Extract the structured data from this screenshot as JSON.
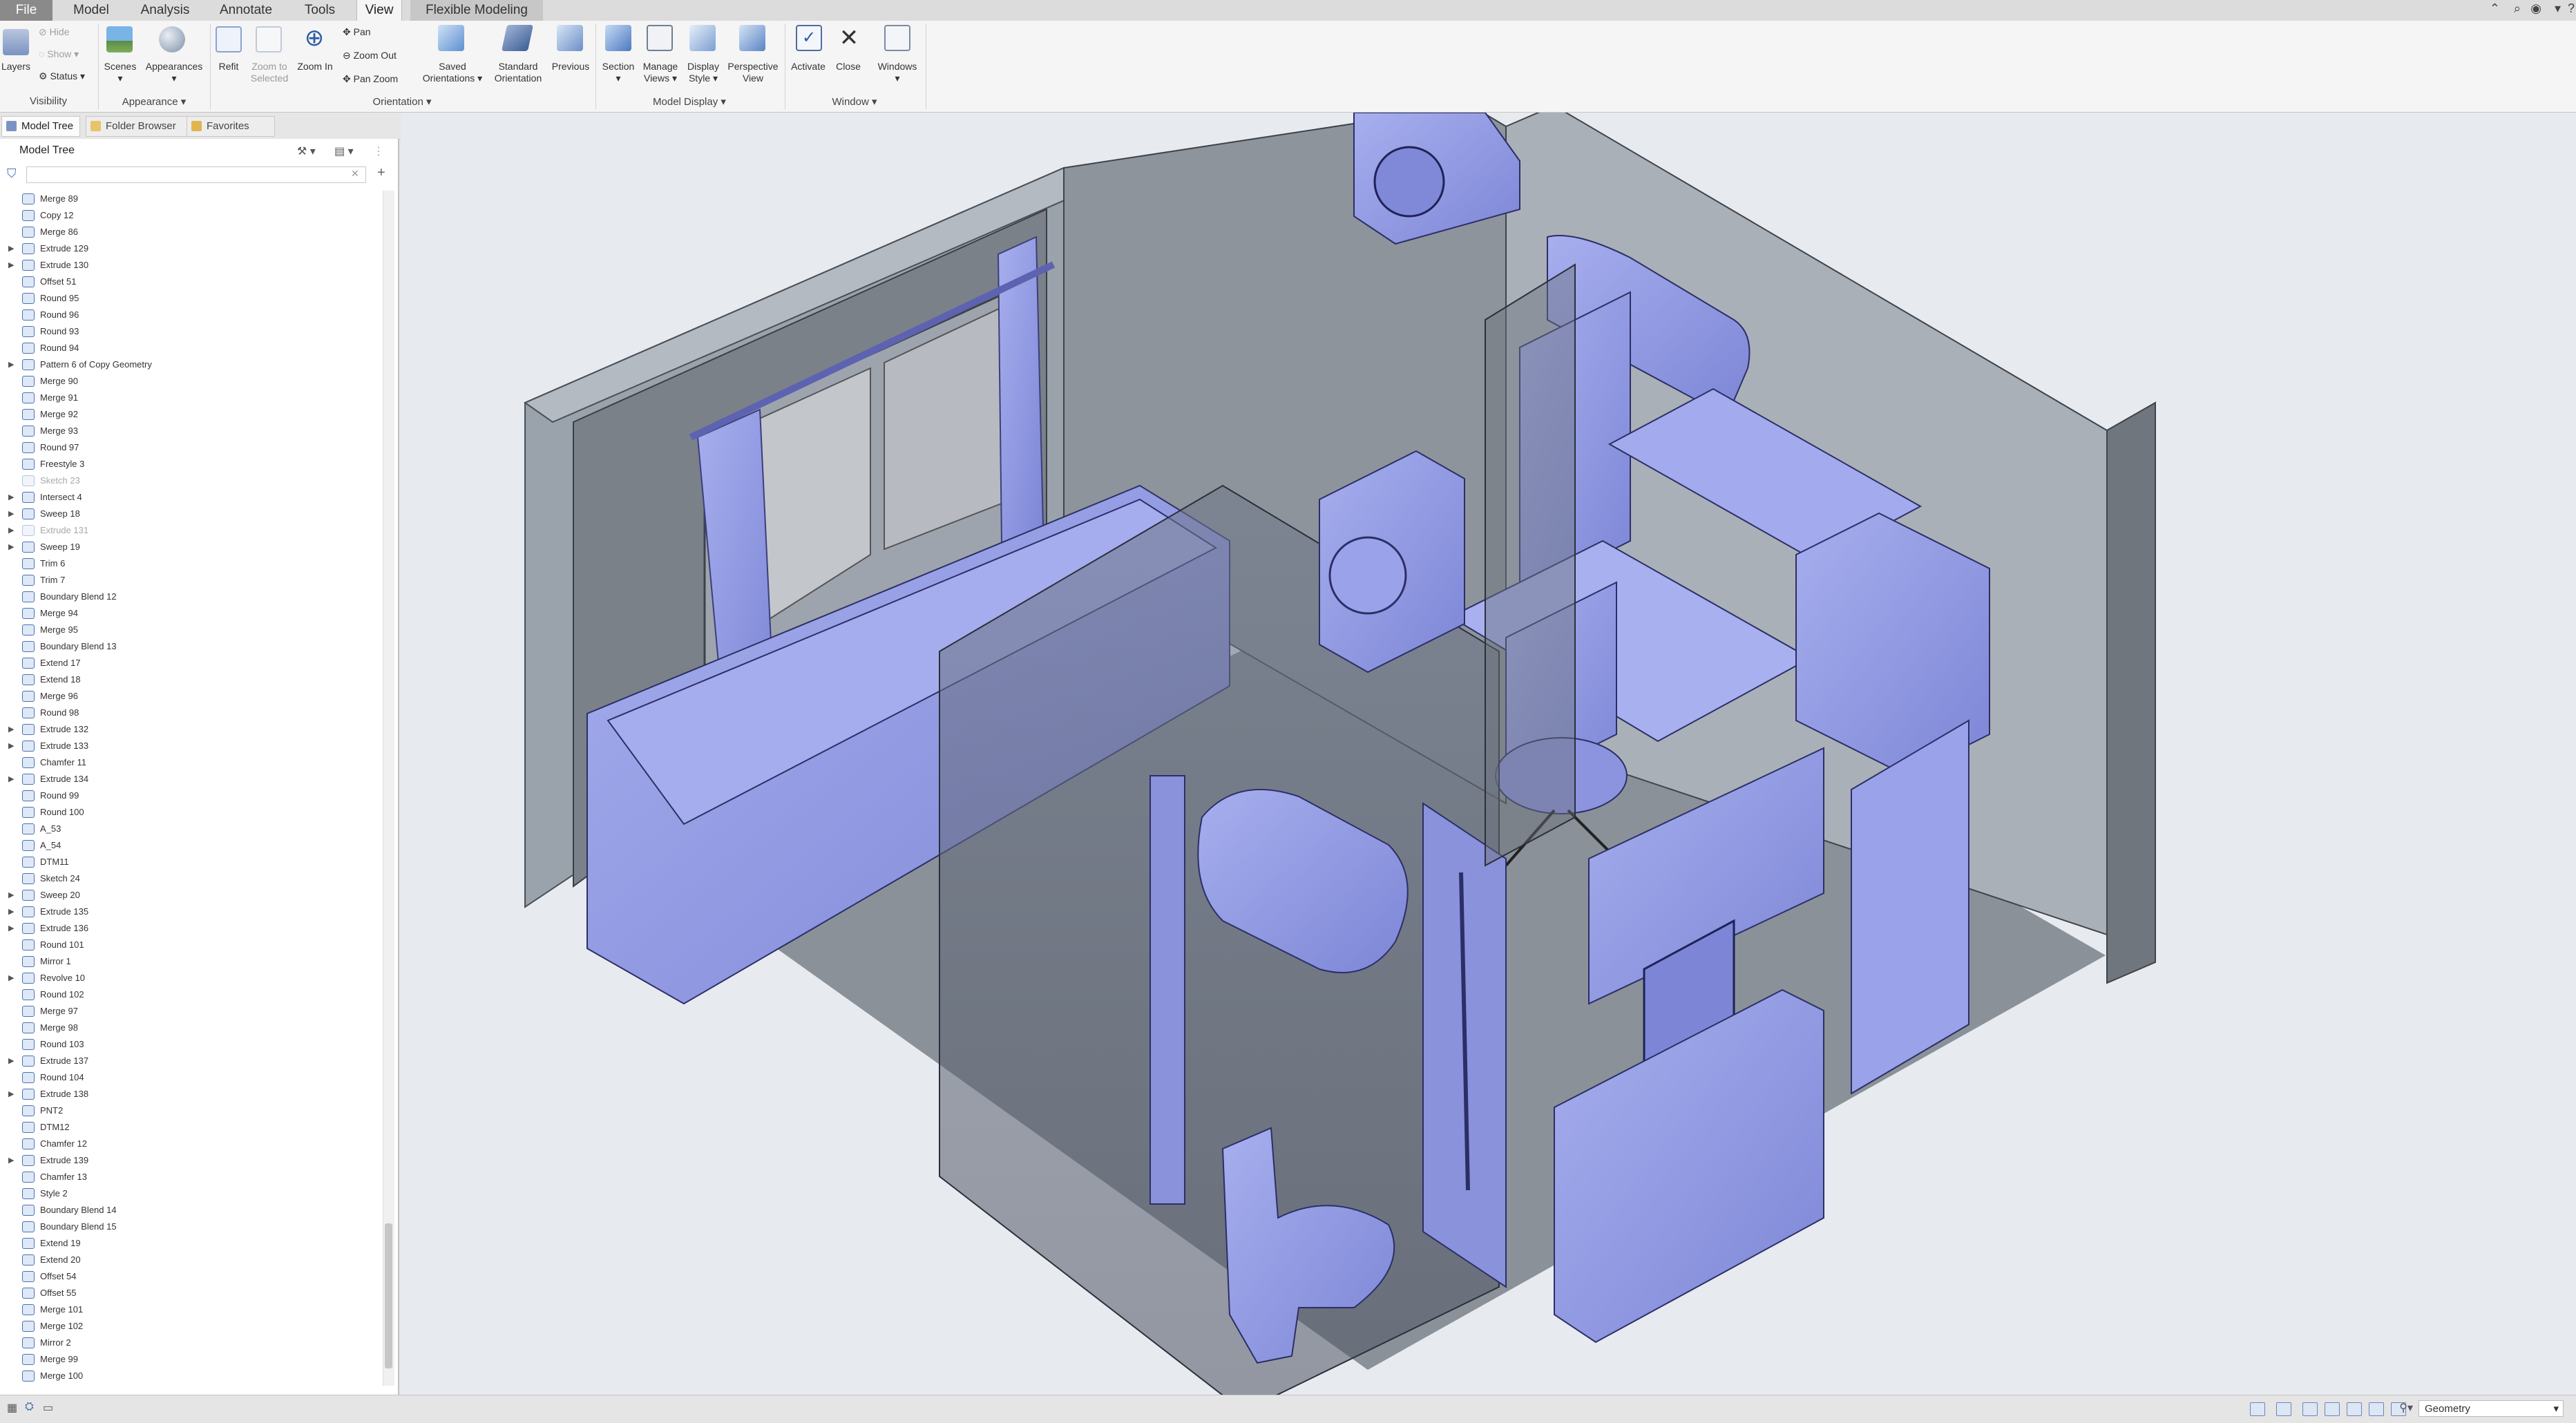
{
  "menu": {
    "tabs": [
      "File",
      "Model",
      "Analysis",
      "Annotate",
      "Tools",
      "View",
      "Flexible Modeling"
    ],
    "active_tab": "View"
  },
  "ribbon": {
    "visibility": {
      "layers": "Layers",
      "hide": "Hide",
      "show": "Show",
      "status": "Status",
      "group": "Visibility"
    },
    "appearance": {
      "scenes": "Scenes",
      "appearances": "Appearances",
      "group": "Appearance"
    },
    "orientation": {
      "refit": "Refit",
      "zoom_to_selected_1": "Zoom to",
      "zoom_to_selected_2": "Selected",
      "zoom_in": "Zoom In",
      "pan": "Pan",
      "zoom_out": "Zoom Out",
      "pan_zoom": "Pan Zoom",
      "saved_orientations_1": "Saved",
      "saved_orientations_2": "Orientations",
      "standard_orientation_1": "Standard",
      "standard_orientation_2": "Orientation",
      "previous": "Previous",
      "group": "Orientation"
    },
    "model_display": {
      "section": "Section",
      "manage_views_1": "Manage",
      "manage_views_2": "Views",
      "display_style_1": "Display",
      "display_style_2": "Style",
      "perspective_view_1": "Perspective",
      "perspective_view_2": "View",
      "group": "Model Display"
    },
    "window": {
      "activate": "Activate",
      "close": "Close",
      "windows": "Windows",
      "group": "Window"
    }
  },
  "side_tabs": [
    "Model Tree",
    "Folder Browser",
    "Favorites"
  ],
  "tree": {
    "title": "Model Tree",
    "items": [
      {
        "label": "Merge 89",
        "expand": false,
        "suppressed": false
      },
      {
        "label": "Copy 12",
        "expand": false,
        "suppressed": false
      },
      {
        "label": "Merge 86",
        "expand": false,
        "suppressed": false
      },
      {
        "label": "Extrude 129",
        "expand": true,
        "suppressed": false
      },
      {
        "label": "Extrude 130",
        "expand": true,
        "suppressed": false
      },
      {
        "label": "Offset 51",
        "expand": false,
        "suppressed": false
      },
      {
        "label": "Round 95",
        "expand": false,
        "suppressed": false
      },
      {
        "label": "Round 96",
        "expand": false,
        "suppressed": false
      },
      {
        "label": "Round 93",
        "expand": false,
        "suppressed": false
      },
      {
        "label": "Round 94",
        "expand": false,
        "suppressed": false
      },
      {
        "label": "Pattern 6 of Copy Geometry",
        "expand": true,
        "suppressed": false
      },
      {
        "label": "Merge 90",
        "expand": false,
        "suppressed": false
      },
      {
        "label": "Merge 91",
        "expand": false,
        "suppressed": false
      },
      {
        "label": "Merge 92",
        "expand": false,
        "suppressed": false
      },
      {
        "label": "Merge 93",
        "expand": false,
        "suppressed": false
      },
      {
        "label": "Round 97",
        "expand": false,
        "suppressed": false
      },
      {
        "label": "Freestyle 3",
        "expand": false,
        "suppressed": false
      },
      {
        "label": "Sketch 23",
        "expand": false,
        "suppressed": true
      },
      {
        "label": "Intersect 4",
        "expand": true,
        "suppressed": false
      },
      {
        "label": "Sweep 18",
        "expand": true,
        "suppressed": false
      },
      {
        "label": "Extrude 131",
        "expand": true,
        "suppressed": true
      },
      {
        "label": "Sweep 19",
        "expand": true,
        "suppressed": false
      },
      {
        "label": "Trim 6",
        "expand": false,
        "suppressed": false
      },
      {
        "label": "Trim 7",
        "expand": false,
        "suppressed": false
      },
      {
        "label": "Boundary Blend 12",
        "expand": false,
        "suppressed": false
      },
      {
        "label": "Merge 94",
        "expand": false,
        "suppressed": false
      },
      {
        "label": "Merge 95",
        "expand": false,
        "suppressed": false
      },
      {
        "label": "Boundary Blend 13",
        "expand": false,
        "suppressed": false
      },
      {
        "label": "Extend 17",
        "expand": false,
        "suppressed": false
      },
      {
        "label": "Extend 18",
        "expand": false,
        "suppressed": false
      },
      {
        "label": "Merge 96",
        "expand": false,
        "suppressed": false
      },
      {
        "label": "Round 98",
        "expand": false,
        "suppressed": false
      },
      {
        "label": "Extrude 132",
        "expand": true,
        "suppressed": false
      },
      {
        "label": "Extrude 133",
        "expand": true,
        "suppressed": false
      },
      {
        "label": "Chamfer 11",
        "expand": false,
        "suppressed": false
      },
      {
        "label": "Extrude 134",
        "expand": true,
        "suppressed": false
      },
      {
        "label": "Round 99",
        "expand": false,
        "suppressed": false
      },
      {
        "label": "Round 100",
        "expand": false,
        "suppressed": false
      },
      {
        "label": "A_53",
        "expand": false,
        "suppressed": false
      },
      {
        "label": "A_54",
        "expand": false,
        "suppressed": false
      },
      {
        "label": "DTM11",
        "expand": false,
        "suppressed": false
      },
      {
        "label": "Sketch 24",
        "expand": false,
        "suppressed": false
      },
      {
        "label": "Sweep 20",
        "expand": true,
        "suppressed": false
      },
      {
        "label": "Extrude 135",
        "expand": true,
        "suppressed": false
      },
      {
        "label": "Extrude 136",
        "expand": true,
        "suppressed": false
      },
      {
        "label": "Round 101",
        "expand": false,
        "suppressed": false
      },
      {
        "label": "Mirror 1",
        "expand": false,
        "suppressed": false
      },
      {
        "label": "Revolve 10",
        "expand": true,
        "suppressed": false
      },
      {
        "label": "Round 102",
        "expand": false,
        "suppressed": false
      },
      {
        "label": "Merge 97",
        "expand": false,
        "suppressed": false
      },
      {
        "label": "Merge 98",
        "expand": false,
        "suppressed": false
      },
      {
        "label": "Round 103",
        "expand": false,
        "suppressed": false
      },
      {
        "label": "Extrude 137",
        "expand": true,
        "suppressed": false
      },
      {
        "label": "Round 104",
        "expand": false,
        "suppressed": false
      },
      {
        "label": "Extrude 138",
        "expand": true,
        "suppressed": false
      },
      {
        "label": "PNT2",
        "expand": false,
        "suppressed": false
      },
      {
        "label": "DTM12",
        "expand": false,
        "suppressed": false
      },
      {
        "label": "Chamfer 12",
        "expand": false,
        "suppressed": false
      },
      {
        "label": "Extrude 139",
        "expand": true,
        "suppressed": false
      },
      {
        "label": "Chamfer 13",
        "expand": false,
        "suppressed": false
      },
      {
        "label": "Style 2",
        "expand": false,
        "suppressed": false
      },
      {
        "label": "Boundary Blend 14",
        "expand": false,
        "suppressed": false
      },
      {
        "label": "Boundary Blend 15",
        "expand": false,
        "suppressed": false
      },
      {
        "label": "Extend 19",
        "expand": false,
        "suppressed": false
      },
      {
        "label": "Extend 20",
        "expand": false,
        "suppressed": false
      },
      {
        "label": "Offset 54",
        "expand": false,
        "suppressed": false
      },
      {
        "label": "Offset 55",
        "expand": false,
        "suppressed": false
      },
      {
        "label": "Merge 101",
        "expand": false,
        "suppressed": false
      },
      {
        "label": "Merge 102",
        "expand": false,
        "suppressed": false
      },
      {
        "label": "Mirror 2",
        "expand": false,
        "suppressed": false
      },
      {
        "label": "Merge 99",
        "expand": false,
        "suppressed": false
      },
      {
        "label": "Merge 100",
        "expand": false,
        "suppressed": false
      }
    ]
  },
  "status": {
    "filter_value": "Geometry"
  },
  "colors": {
    "model_fill": "#8f97e0",
    "wall": "#9ca4ae",
    "wall_dark": "#6c737b",
    "floor": "#8d949c",
    "background": "#e7eaef",
    "accent": "#2b6cc4"
  }
}
